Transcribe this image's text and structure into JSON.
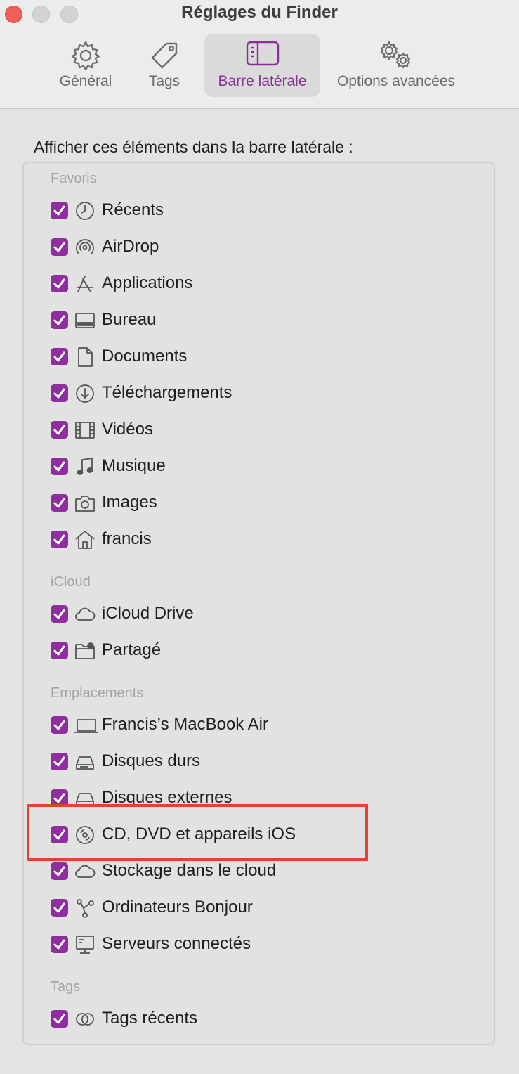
{
  "window": {
    "title": "Réglages du Finder"
  },
  "tabs": [
    {
      "label": "Général",
      "icon": "gear-icon"
    },
    {
      "label": "Tags",
      "icon": "tag-icon"
    },
    {
      "label": "Barre latérale",
      "icon": "sidebar-icon",
      "active": true
    },
    {
      "label": "Options avancées",
      "icon": "gears-icon"
    }
  ],
  "heading": "Afficher ces éléments dans la barre latérale :",
  "accent_color": "#8f2f9f",
  "groups": {
    "favoris": {
      "title": "Favoris",
      "items": [
        {
          "label": "Récents",
          "icon": "clock-icon",
          "checked": true
        },
        {
          "label": "AirDrop",
          "icon": "airdrop-icon",
          "checked": true
        },
        {
          "label": "Applications",
          "icon": "applications-icon",
          "checked": true
        },
        {
          "label": "Bureau",
          "icon": "desktop-icon",
          "checked": true
        },
        {
          "label": "Documents",
          "icon": "document-icon",
          "checked": true
        },
        {
          "label": "Téléchargements",
          "icon": "download-icon",
          "checked": true
        },
        {
          "label": "Vidéos",
          "icon": "film-icon",
          "checked": true
        },
        {
          "label": "Musique",
          "icon": "music-note-icon",
          "checked": true
        },
        {
          "label": "Images",
          "icon": "camera-icon",
          "checked": true
        },
        {
          "label": "francis",
          "icon": "home-icon",
          "checked": true
        }
      ]
    },
    "icloud": {
      "title": "iCloud",
      "items": [
        {
          "label": "iCloud Drive",
          "icon": "cloud-icon",
          "checked": true
        },
        {
          "label": "Partagé",
          "icon": "shared-folder-icon",
          "checked": true
        }
      ]
    },
    "emplacements": {
      "title": "Emplacements",
      "items": [
        {
          "label": "Francis’s MacBook Air",
          "icon": "laptop-icon",
          "checked": true
        },
        {
          "label": "Disques durs",
          "icon": "hard-drive-icon",
          "checked": true
        },
        {
          "label": "Disques externes",
          "icon": "external-drive-icon",
          "checked": true
        },
        {
          "label": "CD, DVD et appareils iOS",
          "icon": "disc-icon",
          "checked": true
        },
        {
          "label": "Stockage dans le cloud",
          "icon": "cloud-icon",
          "checked": true
        },
        {
          "label": "Ordinateurs Bonjour",
          "icon": "bonjour-icon",
          "checked": true
        },
        {
          "label": "Serveurs connectés",
          "icon": "server-icon",
          "checked": true
        }
      ]
    },
    "tags": {
      "title": "Tags",
      "items": [
        {
          "label": "Tags récents",
          "icon": "tags-circles-icon",
          "checked": true
        }
      ]
    }
  }
}
